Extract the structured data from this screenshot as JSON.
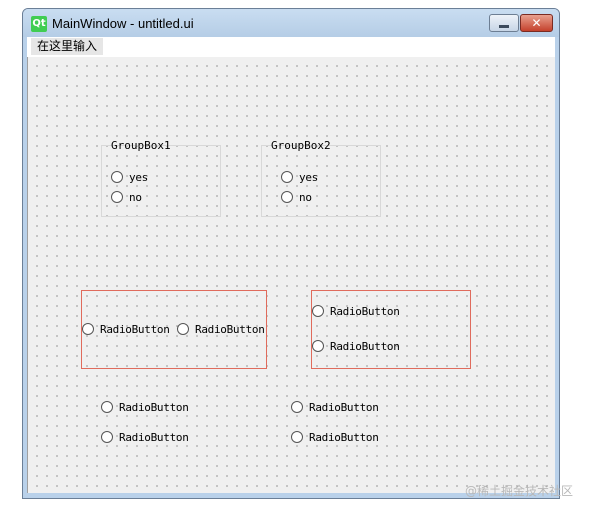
{
  "window": {
    "title": "MainWindow - untitled.ui",
    "app_icon": "qt-logo-icon",
    "app_icon_text": "Qt",
    "close_glyph": "✕"
  },
  "menubar": {
    "placeholder": "在这里输入"
  },
  "groupboxes": [
    {
      "title": "GroupBox1",
      "options": [
        "yes",
        "no"
      ]
    },
    {
      "title": "GroupBox2",
      "options": [
        "yes",
        "no"
      ]
    }
  ],
  "horizontal_layout": {
    "buttons": [
      "RadioButton",
      "RadioButton"
    ]
  },
  "vertical_layout": {
    "buttons": [
      "RadioButton",
      "RadioButton"
    ]
  },
  "free_radios": {
    "left": [
      "RadioButton",
      "RadioButton"
    ],
    "right": [
      "RadioButton",
      "RadioButton"
    ]
  },
  "watermark": "@稀土掘金技术社区",
  "colors": {
    "layout_border": "#e06b5c",
    "groupbox_border": "#d8d8d8",
    "canvas_bg": "#f0f0f0",
    "qt_green": "#41cd52"
  }
}
